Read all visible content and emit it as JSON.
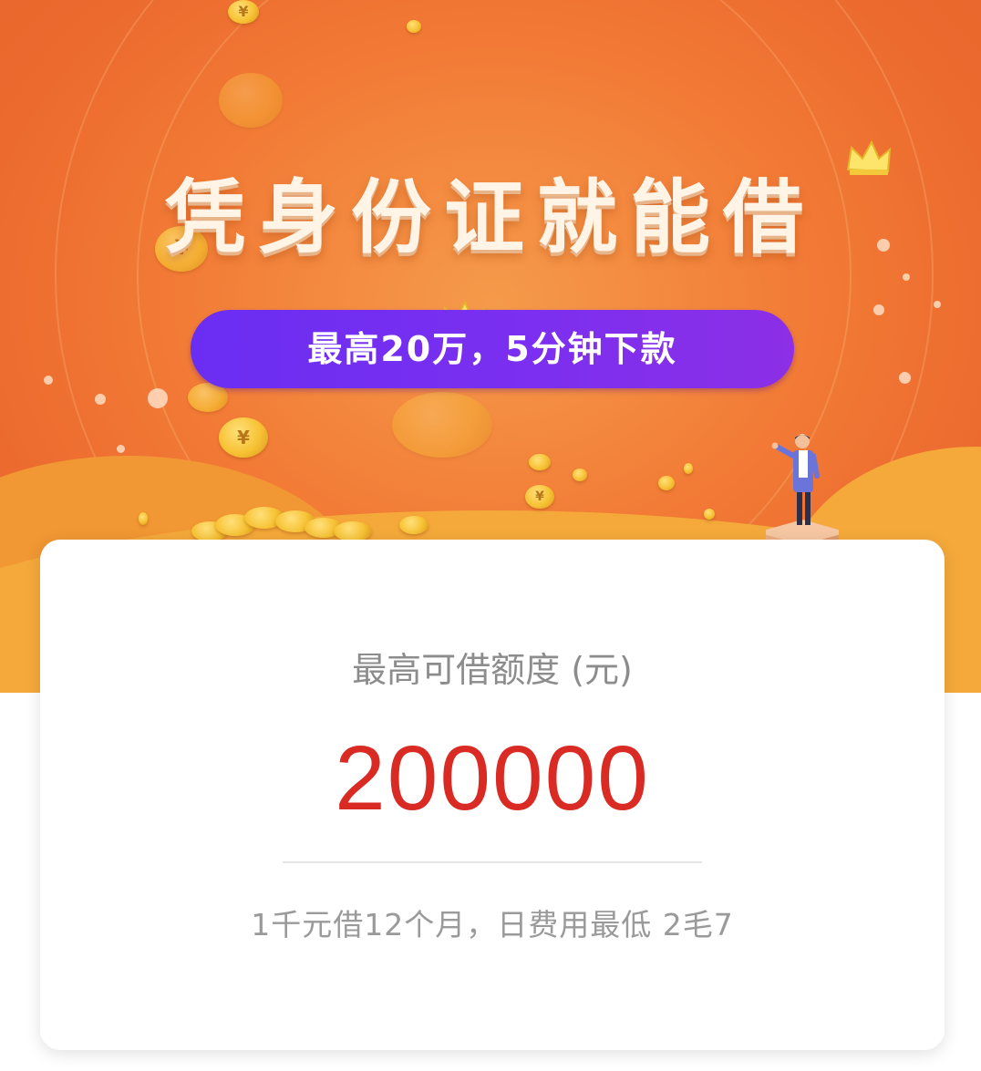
{
  "banner": {
    "headline": "凭身份证就能借",
    "tagline": "最高20万，5分钟下款",
    "colors": {
      "background": "#ef7433",
      "pill": "#7530f0",
      "hills": "#f5a93a",
      "coin": "#f7c234"
    },
    "icons": [
      "crown-icon",
      "coin-icon",
      "person-illustration"
    ]
  },
  "card": {
    "limit_label": "最高可借额度 (元)",
    "limit_amount": "200000",
    "fee_note": "1千元借12个月，日费用最低 2毛7",
    "colors": {
      "amount": "#d92b24",
      "label": "#8c8c8c"
    }
  }
}
